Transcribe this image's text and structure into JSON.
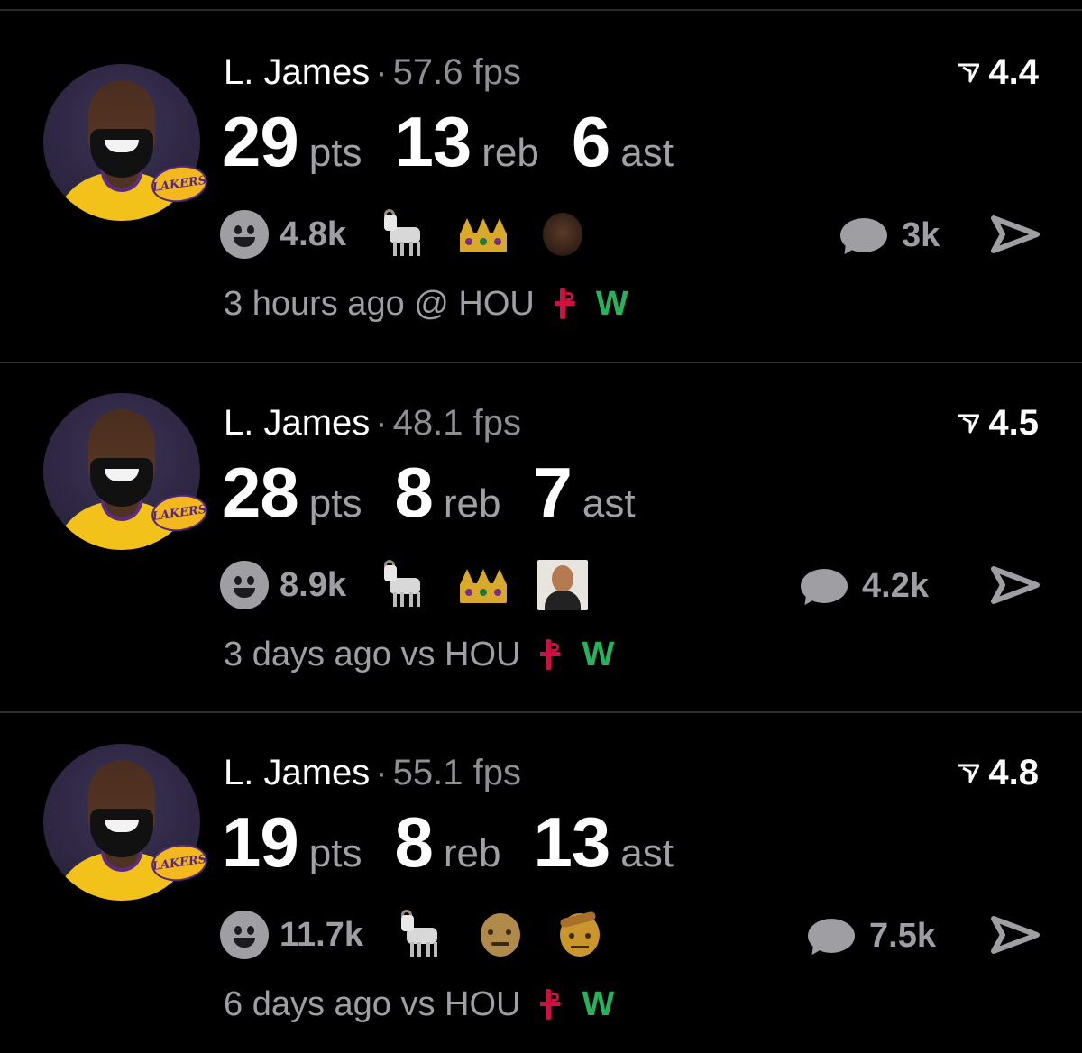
{
  "cards": [
    {
      "player": "L. James",
      "separator": "·",
      "fps": "57.6 fps",
      "rating": "4.4",
      "stats": [
        {
          "value": "29",
          "unit": "pts"
        },
        {
          "value": "13",
          "unit": "reb"
        },
        {
          "value": "6",
          "unit": "ast"
        }
      ],
      "reaction_count": "4.8k",
      "reaction_emojis": [
        "goat-icon",
        "crown-icon",
        "face-icon"
      ],
      "comment_count": "3k",
      "meta": "3 hours ago @ HOU",
      "result": "W"
    },
    {
      "player": "L. James",
      "separator": "·",
      "fps": "48.1 fps",
      "rating": "4.5",
      "stats": [
        {
          "value": "28",
          "unit": "pts"
        },
        {
          "value": "8",
          "unit": "reb"
        },
        {
          "value": "7",
          "unit": "ast"
        }
      ],
      "reaction_count": "8.9k",
      "reaction_emojis": [
        "goat-icon",
        "crown-icon",
        "face-icon"
      ],
      "comment_count": "4.2k",
      "meta": "3 days ago vs HOU",
      "result": "W"
    },
    {
      "player": "L. James",
      "separator": "·",
      "fps": "55.1 fps",
      "rating": "4.8",
      "stats": [
        {
          "value": "19",
          "unit": "pts"
        },
        {
          "value": "8",
          "unit": "reb"
        },
        {
          "value": "13",
          "unit": "ast"
        }
      ],
      "reaction_count": "11.7k",
      "reaction_emojis": [
        "goat-icon",
        "old-man-face-icon",
        "saluting-face-icon"
      ],
      "comment_count": "7.5k",
      "meta": "6 days ago vs HOU",
      "result": "W"
    }
  ],
  "team_logo_text": "LAKERS",
  "colors": {
    "background": "#000000",
    "secondary_text": "#8e8e93",
    "win": "#27b35c",
    "opponent_logo": "#ce1141"
  }
}
